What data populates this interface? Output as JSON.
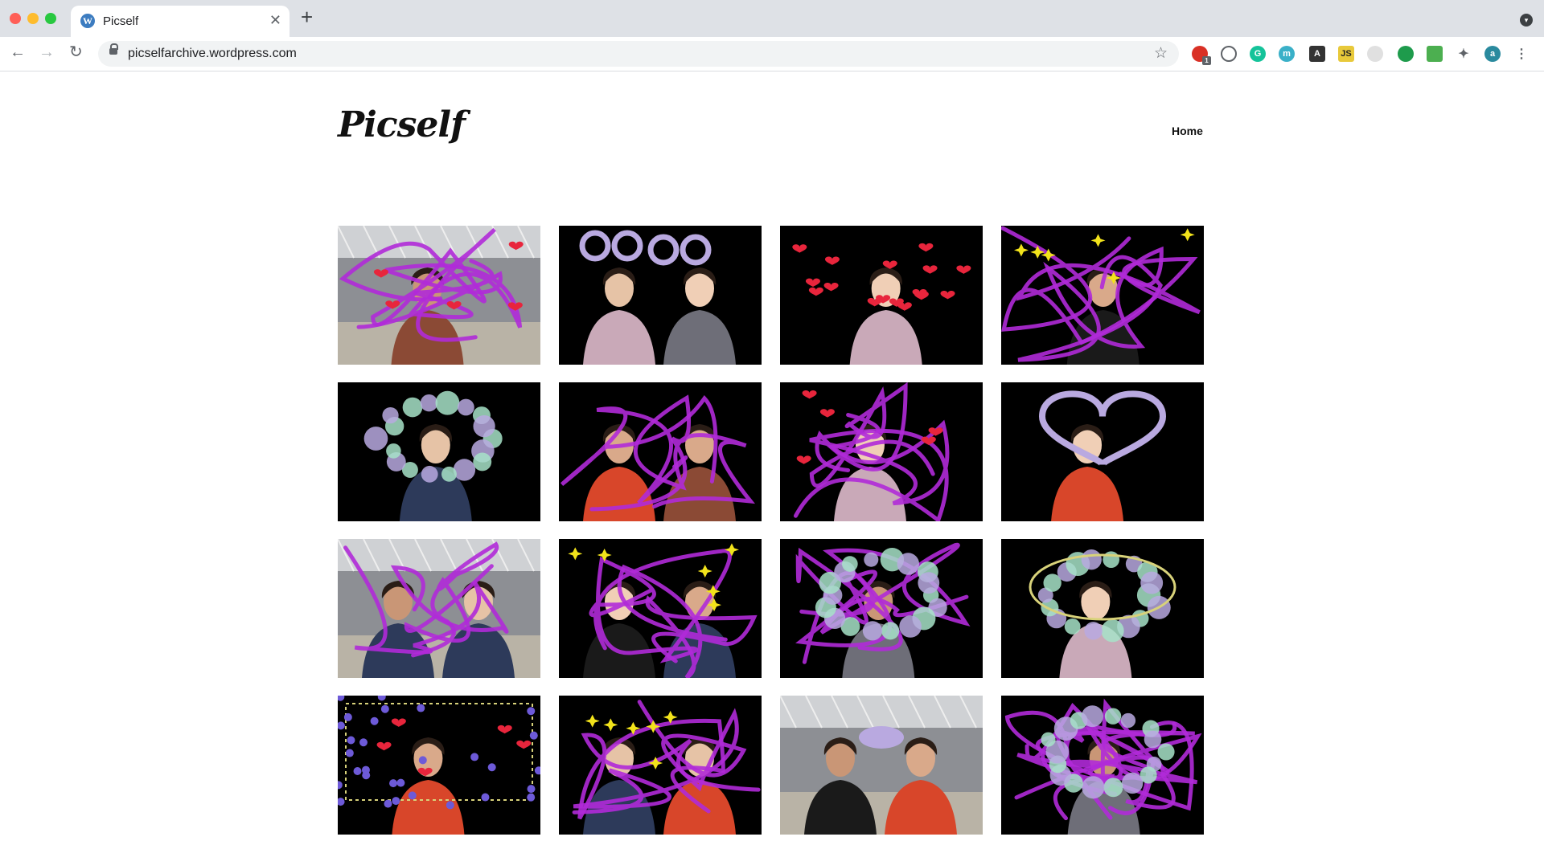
{
  "browser": {
    "tab_title": "Picself",
    "url": "picselfarchive.wordpress.com",
    "new_tab_symbol": "+",
    "close_symbol": "✕",
    "extension_badge": "1"
  },
  "site": {
    "title": "Picself",
    "nav": [
      {
        "label": "Home"
      }
    ]
  },
  "gallery": [
    {
      "bg": "office",
      "overlay": "hearts-squiggle"
    },
    {
      "bg": "dark",
      "overlay": "ears"
    },
    {
      "bg": "dark",
      "overlay": "hearts"
    },
    {
      "bg": "dark",
      "overlay": "stars-squiggle"
    },
    {
      "bg": "dark",
      "overlay": "bubbles"
    },
    {
      "bg": "dark",
      "overlay": "squiggle"
    },
    {
      "bg": "dark",
      "overlay": "squiggle-hearts"
    },
    {
      "bg": "dark",
      "overlay": "heart-outline"
    },
    {
      "bg": "office",
      "overlay": "squiggle"
    },
    {
      "bg": "dark",
      "overlay": "stars-squiggle"
    },
    {
      "bg": "dark",
      "overlay": "bubbles-squiggle"
    },
    {
      "bg": "dark",
      "overlay": "rings"
    },
    {
      "bg": "dark",
      "overlay": "dancers-hearts"
    },
    {
      "bg": "dark",
      "overlay": "stars-squiggle"
    },
    {
      "bg": "office",
      "overlay": "hat"
    },
    {
      "bg": "dark",
      "overlay": "scribble"
    }
  ],
  "colors": {
    "magenta": "#b02ad8",
    "heart": "#e8253c",
    "star": "#f2e31b",
    "lilac": "#b9a9e0",
    "mint": "#a7e3c8",
    "yellowgrid": "#d8d27a",
    "dancer": "#6d5ad8"
  },
  "icons": [
    "wordpress-icon",
    "lock-icon",
    "star-icon",
    "extension-icon",
    "puzzle-icon",
    "profile-icon",
    "menu-icon"
  ]
}
